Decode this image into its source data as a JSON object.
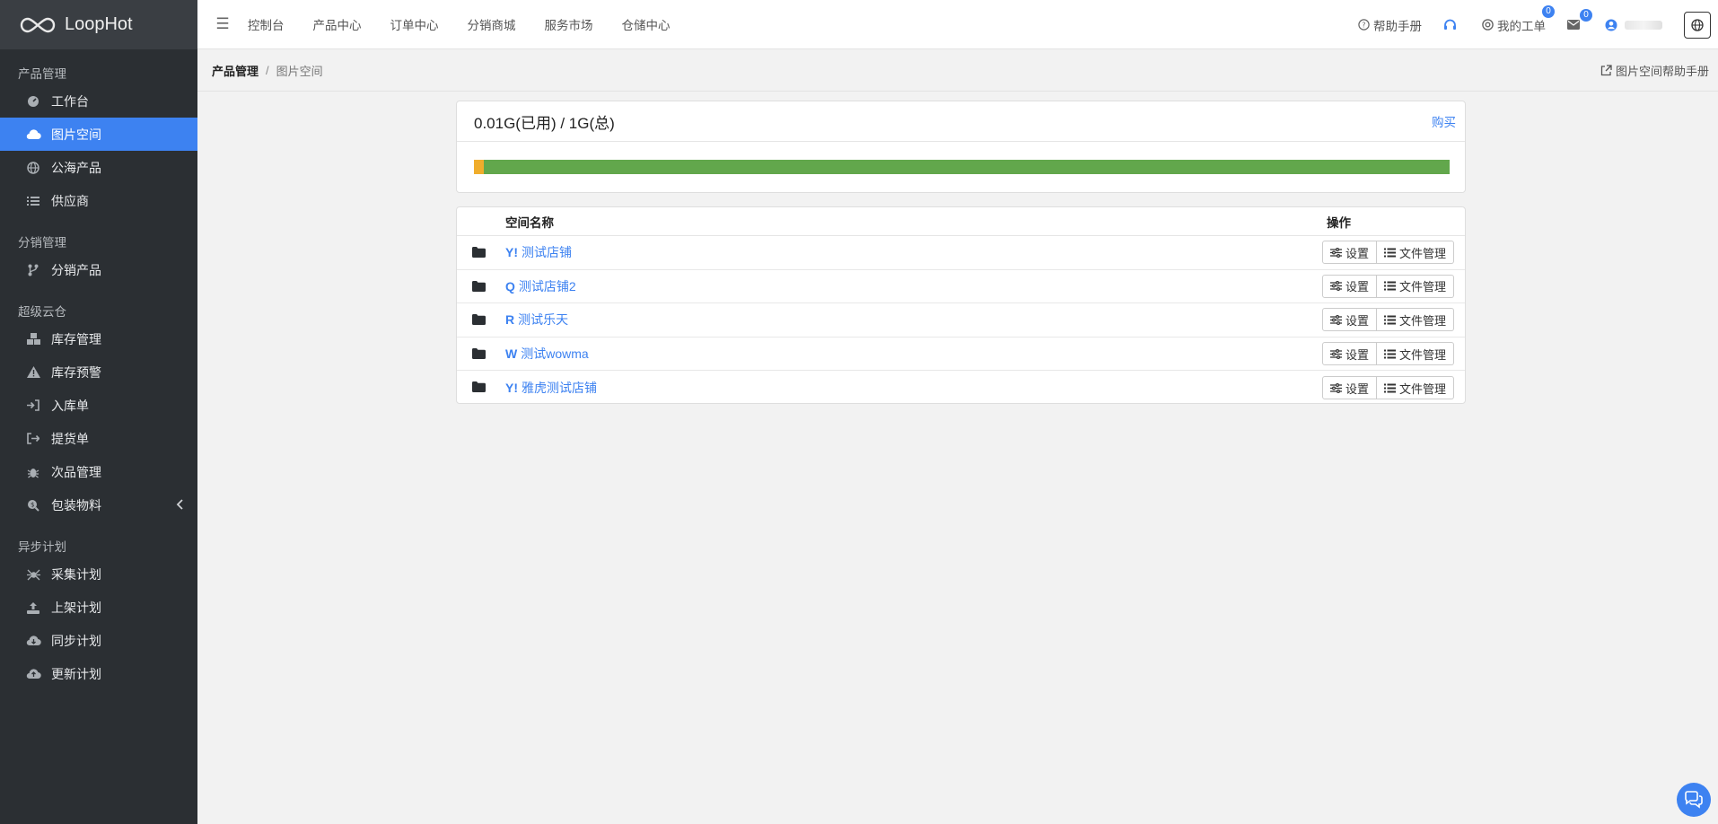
{
  "brand": {
    "name": "LoopHot"
  },
  "sidebar": {
    "sections": [
      {
        "title": "产品管理",
        "items": [
          {
            "label": "工作台",
            "icon": "dashboard-icon"
          },
          {
            "label": "图片空间",
            "icon": "cloud-icon",
            "active": true
          },
          {
            "label": "公海产品",
            "icon": "globe-icon"
          },
          {
            "label": "供应商",
            "icon": "list-icon"
          }
        ]
      },
      {
        "title": "分销管理",
        "items": [
          {
            "label": "分销产品",
            "icon": "branch-icon"
          }
        ]
      },
      {
        "title": "超级云仓",
        "items": [
          {
            "label": "库存管理",
            "icon": "boxes-icon"
          },
          {
            "label": "库存预警",
            "icon": "warning-icon"
          },
          {
            "label": "入库单",
            "icon": "sign-in-icon"
          },
          {
            "label": "提货单",
            "icon": "sign-out-icon"
          },
          {
            "label": "次品管理",
            "icon": "bug-icon"
          },
          {
            "label": "包装物料",
            "icon": "search-dollar-icon"
          }
        ]
      },
      {
        "title": "异步计划",
        "items": [
          {
            "label": "采集计划",
            "icon": "spider-icon"
          },
          {
            "label": "上架计划",
            "icon": "upload-icon"
          },
          {
            "label": "同步计划",
            "icon": "cloud-download-icon"
          },
          {
            "label": "更新计划",
            "icon": "cloud-upload-icon"
          }
        ]
      }
    ]
  },
  "topnav": {
    "items": [
      "控制台",
      "产品中心",
      "订单中心",
      "分销商城",
      "服务市场",
      "仓储中心"
    ]
  },
  "topright": {
    "help": "帮助手册",
    "tickets": "我的工单",
    "tickets_badge": "0",
    "mail_badge": "0"
  },
  "breadcrumb": {
    "parent": "产品管理",
    "sep": "/",
    "current": "图片空间",
    "help": "图片空间帮助手册"
  },
  "usage": {
    "title": "0.01G(已用) / 1G(总)",
    "buy": "购买",
    "used_fraction": 0.01,
    "colors": {
      "used": "#f0ad2c",
      "free": "#62a74c"
    }
  },
  "table": {
    "headers": {
      "name": "空间名称",
      "ops": "操作"
    },
    "rows": [
      {
        "platform": "Y!",
        "name": "测试店铺"
      },
      {
        "platform": "Q",
        "name": "测试店铺2"
      },
      {
        "platform": "R",
        "name": "测试乐天"
      },
      {
        "platform": "W",
        "name": "测试wowma"
      },
      {
        "platform": "Y!",
        "name": "雅虎测试店铺"
      }
    ],
    "btn_settings": "设置",
    "btn_files": "文件管理"
  }
}
